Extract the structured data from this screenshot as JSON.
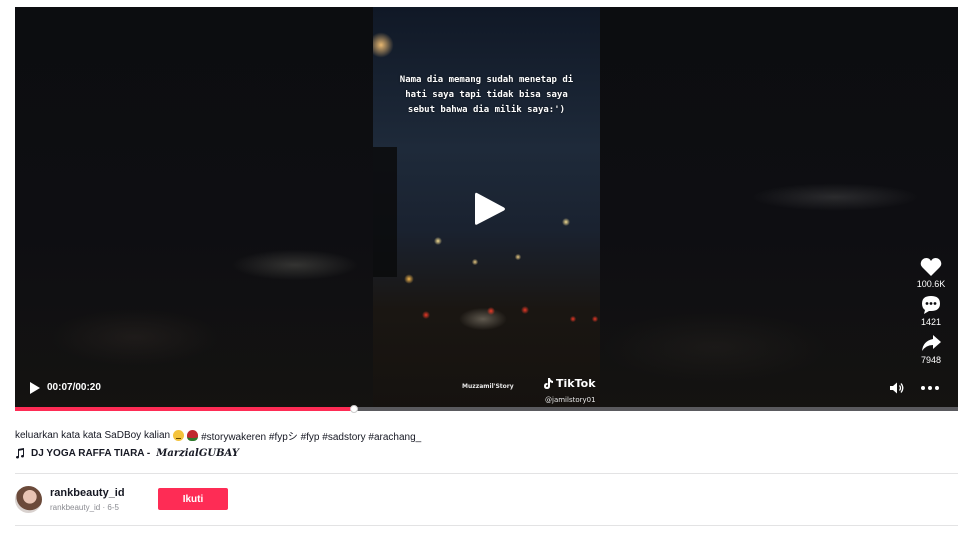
{
  "video": {
    "overlay_caption": "Nama dia memang sudah menetap di hati saya tapi tidak bisa saya sebut bahwa dia milik saya:')",
    "watermark_left": "Muzzamil'Story",
    "watermark_brand": "TikTok",
    "watermark_handle": "@jamilstory01",
    "time": "00:07/00:20",
    "progress": 0.36
  },
  "actions": {
    "likes": "100.6K",
    "comments": "1421",
    "shares": "7948"
  },
  "description": {
    "text": "keluarkan kata kata SaDBoy kalian",
    "hashtags": "#storywakeren #fypシ #fyp #sadstory #arachang_"
  },
  "music": {
    "title": "DJ YOGA RAFFA TIARA -",
    "artist": "MarzialGUBAY"
  },
  "author": {
    "username": "rankbeauty_id",
    "subline": "rankbeauty_id · 6-5",
    "follow_label": "Ikuti"
  },
  "colors": {
    "accent": "#fe2c55",
    "player_bg": "#0b0b0e"
  },
  "icons": [
    "play-icon",
    "heart-icon",
    "comment-icon",
    "share-icon",
    "volume-icon",
    "more-icon",
    "music-note-icon",
    "tiktok-logo-icon"
  ]
}
